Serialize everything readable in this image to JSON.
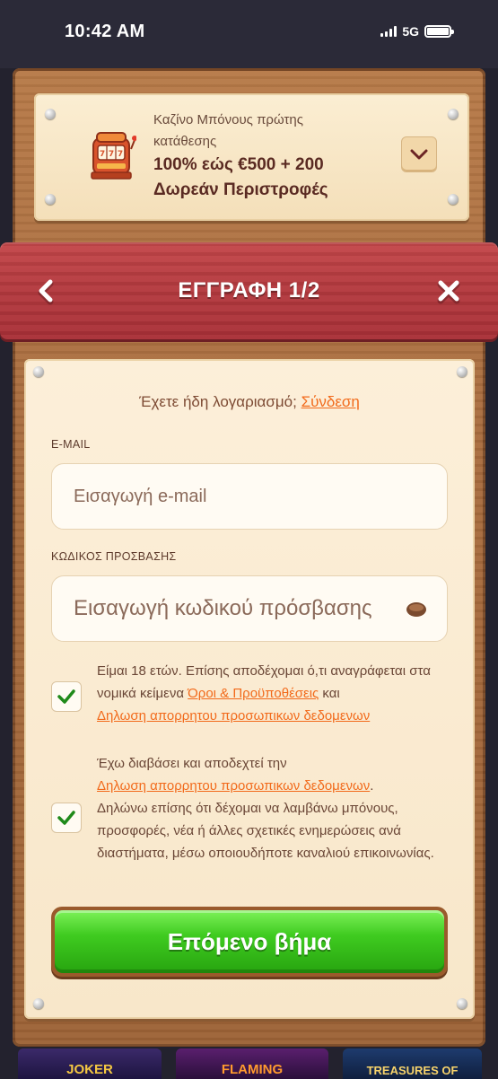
{
  "status_bar": {
    "time": "10:42 AM",
    "network": "5G"
  },
  "bonus": {
    "subtitle": "Καζίνο Μπόνους πρώτης κατάθεσης",
    "title": "100% εώς €500 + 200 Δωρεάν Περιστροφές"
  },
  "header": {
    "title": "ΕΓΓΡΑΦΗ 1/2"
  },
  "form": {
    "login_prompt": "Έχετε ήδη λογαριασμό;",
    "login_link": "Σύνδεση",
    "email_label": "E-MAIL",
    "email_placeholder": "Εισαγωγή e-mail",
    "password_label": "ΚΩΔΙΚΟΣ ΠΡΟΣΒΑΣΗΣ",
    "password_placeholder": "Εισαγωγή κωδικού πρόσβασης",
    "consent1": {
      "checked": true,
      "text_a": "Είμαι 18 ετών. Επίσης αποδέχομαι ό,τι αναγράφεται στα νομικά κείμενα ",
      "link_terms": "Όροι & Προϋποθέσεις",
      "text_b": " και",
      "link_privacy": "Δηλωση απορρητου προσωπικων δεδομενων"
    },
    "consent2": {
      "checked": true,
      "text_a": "Έχω διαβάσει και αποδεχτεί την",
      "link_privacy": "Δηλωση απορρητου προσωπικων δεδομενων",
      "text_b": ".",
      "text_c": "Δηλώνω επίσης ότι δέχομαι να λαμβάνω μπόνους, προσφορές, νέα ή άλλες σχετικές ενημερώσεις ανά διαστήματα, μέσω οποιουδήποτε καναλιού επικοινωνίας."
    },
    "next_button": "Επόμενο βήμα"
  },
  "games": [
    {
      "label": "JOKER"
    },
    {
      "label": "FLAMING"
    },
    {
      "label": "TREASURES OF"
    }
  ],
  "colors": {
    "header_red": "#b53a3f",
    "link_orange": "#f26a1b",
    "button_green": "#3fcb20",
    "card_cream": "#fcefd9"
  }
}
